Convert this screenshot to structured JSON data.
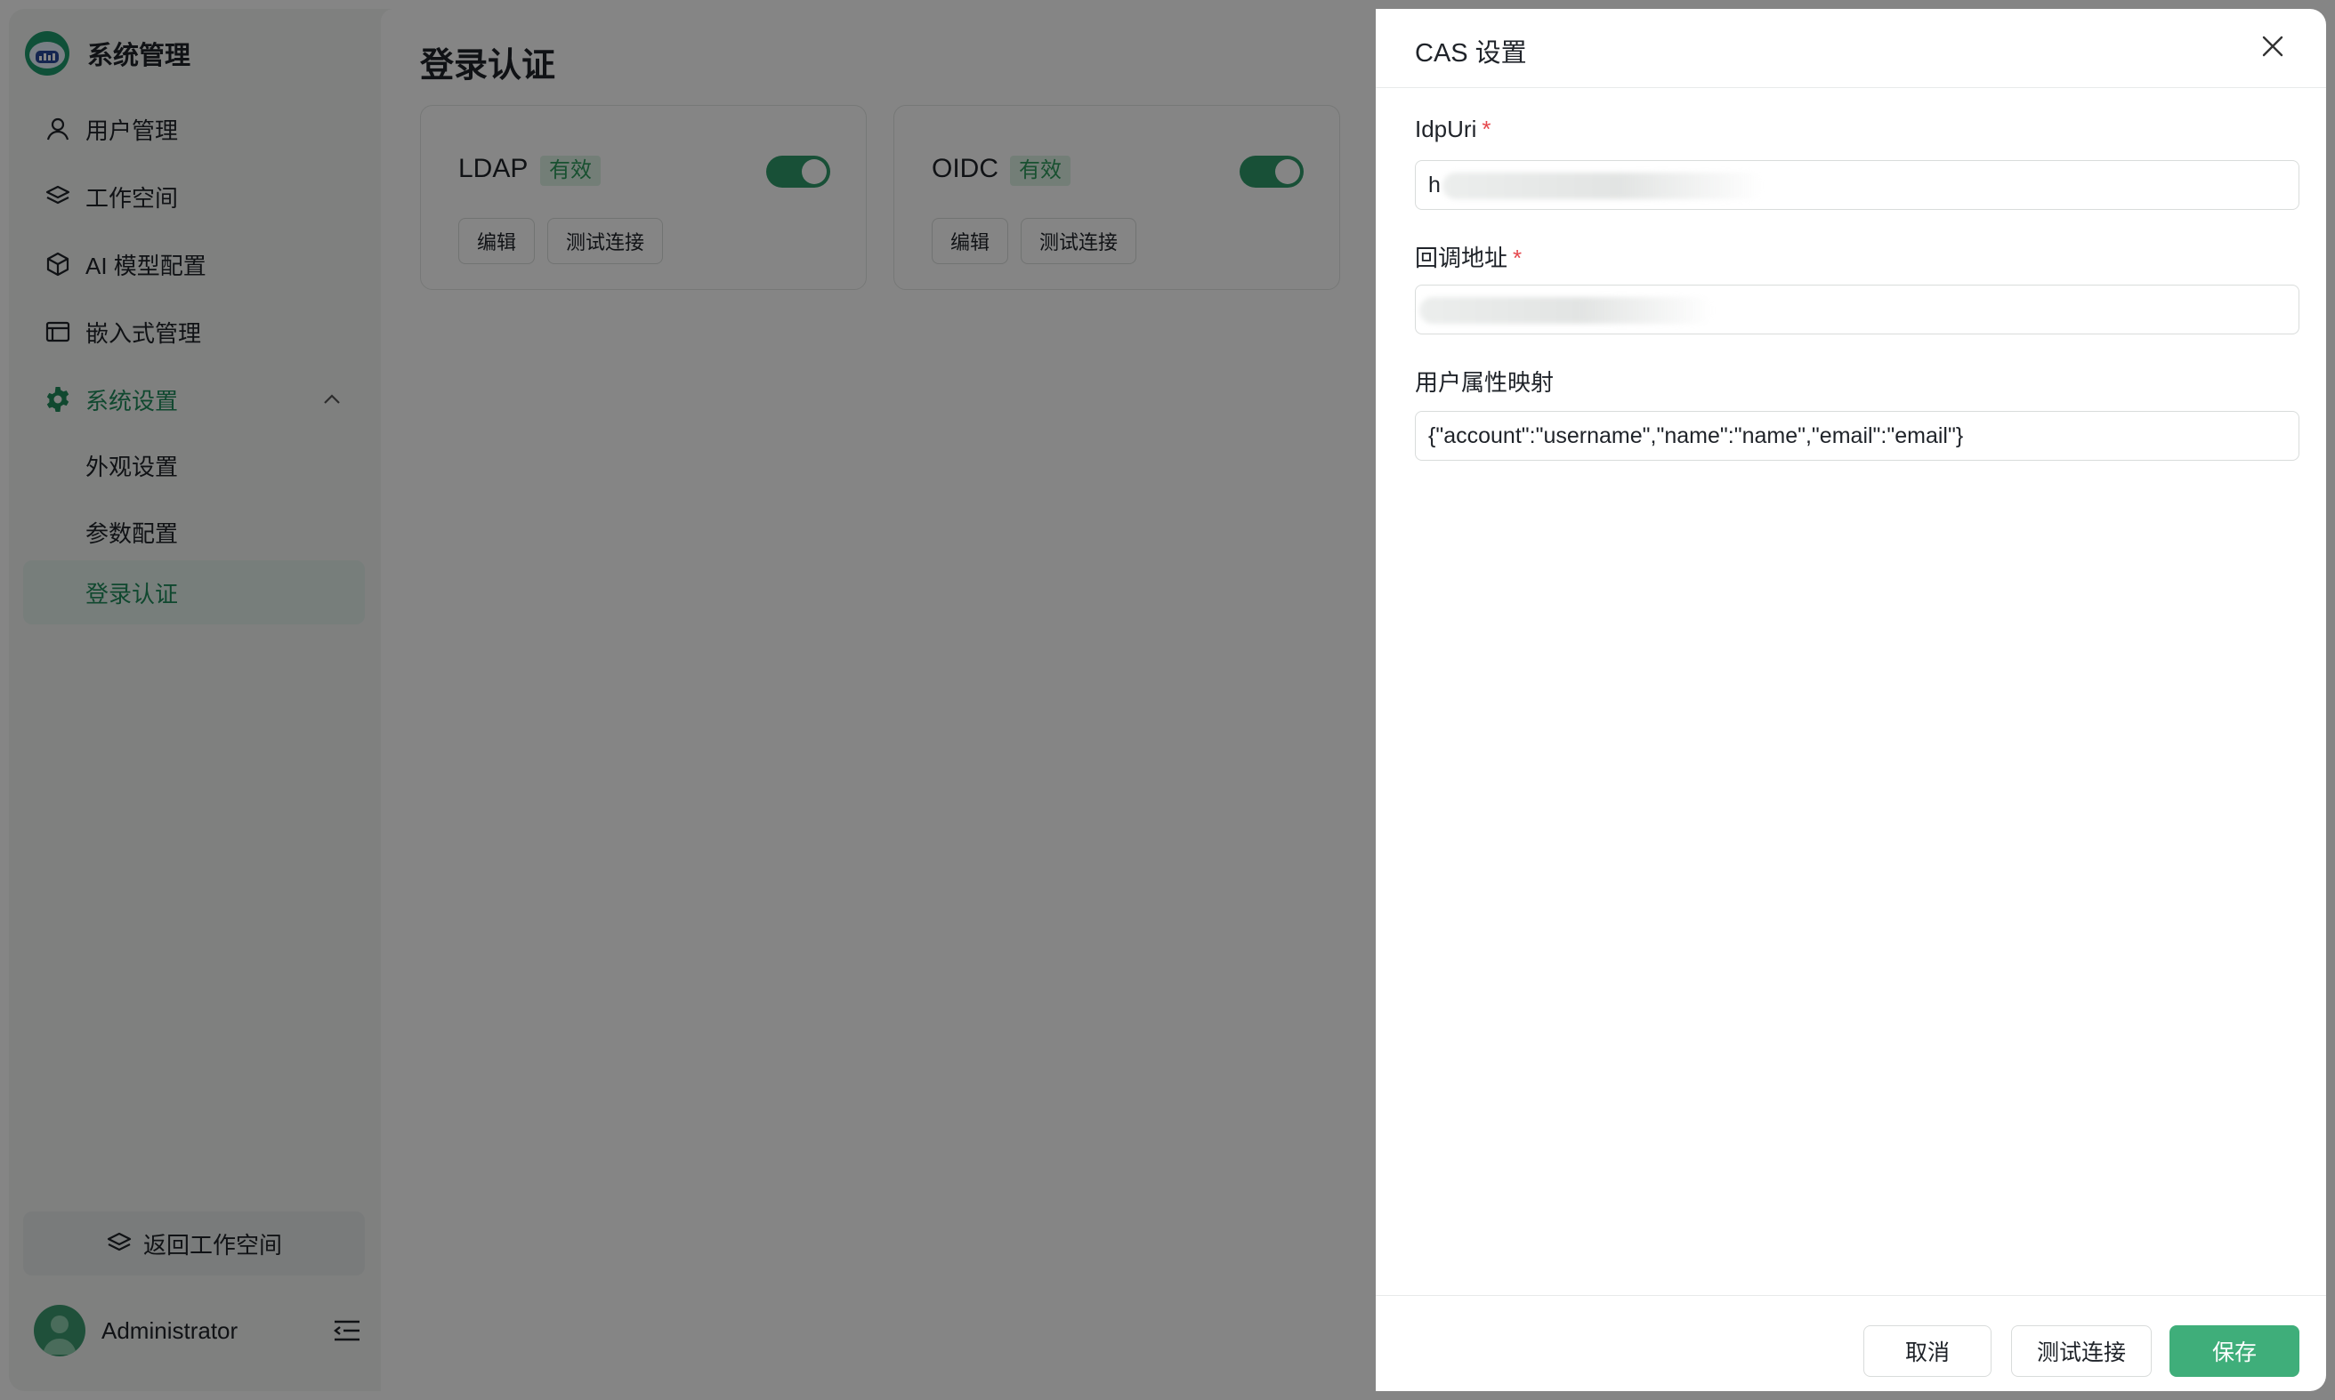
{
  "sidebar": {
    "title": "系统管理",
    "items": [
      {
        "label": "用户管理"
      },
      {
        "label": "工作空间"
      },
      {
        "label": "AI 模型配置"
      },
      {
        "label": "嵌入式管理"
      }
    ],
    "group": {
      "label": "系统设置",
      "children": [
        {
          "label": "外观设置"
        },
        {
          "label": "参数配置"
        },
        {
          "label": "登录认证",
          "active": true
        }
      ]
    },
    "back_label": "返回工作空间",
    "user_name": "Administrator"
  },
  "main": {
    "title": "登录认证",
    "cards": [
      {
        "name": "LDAP",
        "badge": "有效",
        "enabled": true,
        "edit_label": "编辑",
        "test_label": "测试连接"
      },
      {
        "name": "OIDC",
        "badge": "有效",
        "enabled": true,
        "edit_label": "编辑",
        "test_label": "测试连接"
      }
    ]
  },
  "drawer": {
    "title": "CAS 设置",
    "fields": [
      {
        "label": "IdpUri",
        "required": true,
        "value": "h"
      },
      {
        "label": "回调地址",
        "required": true,
        "value": ""
      },
      {
        "label": "用户属性映射",
        "required": false,
        "value": "{\"account\":\"username\",\"name\":\"name\",\"email\":\"email\"}"
      }
    ],
    "cancel_label": "取消",
    "test_label": "测试连接",
    "save_label": "保存"
  },
  "colors": {
    "accent": "#3fae7a",
    "accent_text": "#1f8a5b",
    "badge_bg": "#dcf2e4",
    "required": "#e5484d"
  },
  "icons": [
    "logo-icon",
    "user-icon",
    "layers-icon",
    "cube-icon",
    "window-icon",
    "gear-icon",
    "chevron-up-icon",
    "layers-icon",
    "avatar-icon",
    "menu-collapse-icon",
    "close-icon"
  ]
}
